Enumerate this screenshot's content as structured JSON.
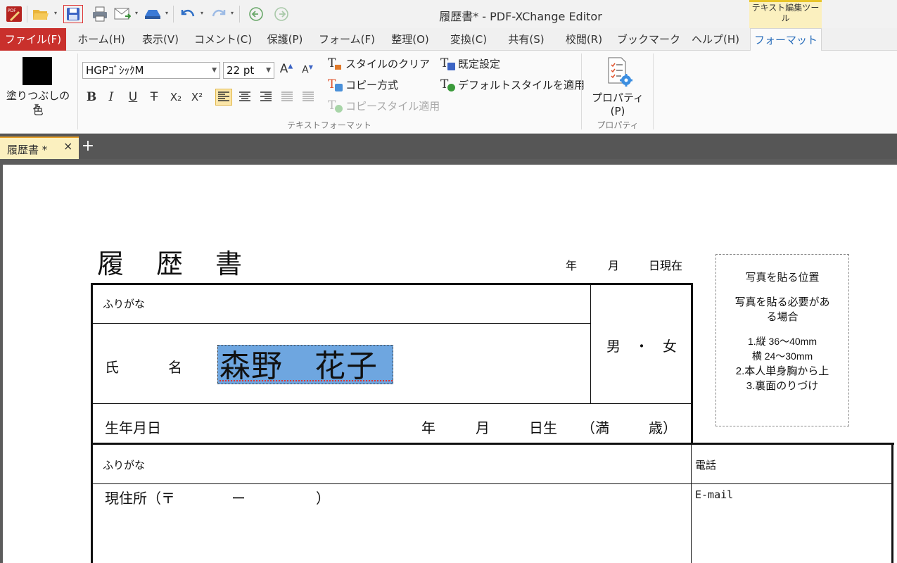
{
  "window": {
    "title": "履歴書* - PDF-XChange Editor",
    "context_group": "テキスト編集ツール"
  },
  "quick_access": [
    "app-logo-icon",
    "open-folder-icon",
    "save-icon",
    "print-icon",
    "email-icon",
    "scan-icon",
    "undo-icon",
    "redo-icon",
    "back-icon",
    "forward-icon"
  ],
  "menu": {
    "tabs": [
      "ファイル(F)",
      "ホーム(H)",
      "表示(V)",
      "コメント(C)",
      "保護(P)",
      "フォーム(F)",
      "整理(O)",
      "変換(C)",
      "共有(S)",
      "校閲(R)",
      "ブックマーク",
      "ヘルプ(H)",
      "フォーマット"
    ],
    "active_tab": "フォーマット"
  },
  "ribbon": {
    "fill_label": "塗りつぶしの色",
    "fill_color": "#000000",
    "font_name": "HGPｺﾞｼｯｸM",
    "font_size": "22 pt",
    "grow_font": "A",
    "shrink_font": "A",
    "format_buttons": [
      "B",
      "I",
      "U",
      "T",
      "X₂",
      "X²"
    ],
    "clear_style": "スタイルのクリア",
    "copy_method": "コピー方式",
    "copy_style_apply": "コピースタイル適用",
    "default_setting": "既定設定",
    "apply_default_style": "デフォルトスタイルを適用",
    "text_format_group": "テキストフォーマット",
    "properties_button": "プロパティ(P)",
    "properties_group": "プロパティ"
  },
  "doc_tabs": {
    "active": "履歴書 *",
    "close": "×",
    "new": "+"
  },
  "document": {
    "title": "履　歴　書",
    "date_year": "年",
    "date_month": "月",
    "date_day": "日現在",
    "furigana_1": "ふりがな",
    "name_label_1": "氏",
    "name_label_2": "名",
    "name_value": "森野　花子",
    "gender": "男　・　女",
    "birth_label": "生年月日",
    "birth_year": "年",
    "birth_month": "月",
    "birth_day": "日生",
    "age_open": "（満",
    "age_close": "歳）",
    "furigana_2": "ふりがな",
    "address_label": "現住所（〒　　　　ー　　　　　）",
    "phone_label": "電話",
    "email_label": "E-mail",
    "photo": {
      "title": "写真を貼る位置",
      "note_1": "写真を貼る必要があ",
      "note_2": "る場合",
      "rule_1": "1.縦  36～40mm",
      "rule_2": "横  24～30mm",
      "rule_3": "2.本人単身胸から上",
      "rule_4": "3.裏面のりづけ"
    }
  },
  "colors": {
    "file_tab": "#c9302c",
    "active_tab_text": "#2a6ebb",
    "context_tab": "#fbf0bf",
    "selection": "#6ea6e0"
  }
}
